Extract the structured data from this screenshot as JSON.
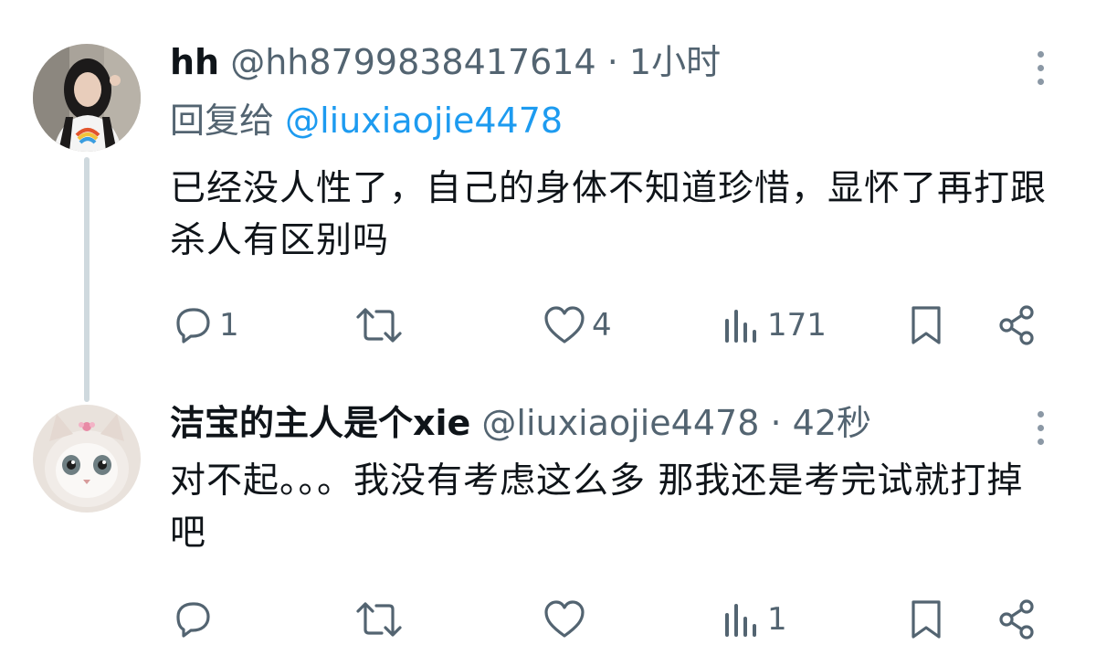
{
  "tweets": [
    {
      "name": "hh",
      "handle": "@hh8799838417614",
      "time": "· 1小时",
      "reply_prefix": "回复给",
      "reply_to": "@liuxiaojie4478",
      "text": "已经没人性了，自己的身体不知道珍惜，显怀了再打跟杀人有区别吗",
      "counts": {
        "replies": "1",
        "reposts": "",
        "likes": "4",
        "views": "171"
      }
    },
    {
      "name": "洁宝的主人是个xie",
      "handle": "@liuxiaojie4478",
      "time": "· 42秒",
      "text": "对不起。。。我没有考虑这么多 那我还是考完试就打掉吧",
      "counts": {
        "replies": "",
        "reposts": "",
        "likes": "",
        "views": "1"
      }
    }
  ],
  "icons": [
    "more-icon",
    "reply-icon",
    "repost-icon",
    "like-icon",
    "views-icon",
    "bookmark-icon",
    "share-icon"
  ],
  "colors": {
    "text": "#0f1419",
    "meta": "#536471",
    "mention": "#1d9bf0",
    "thread_line": "#cfd9de"
  }
}
